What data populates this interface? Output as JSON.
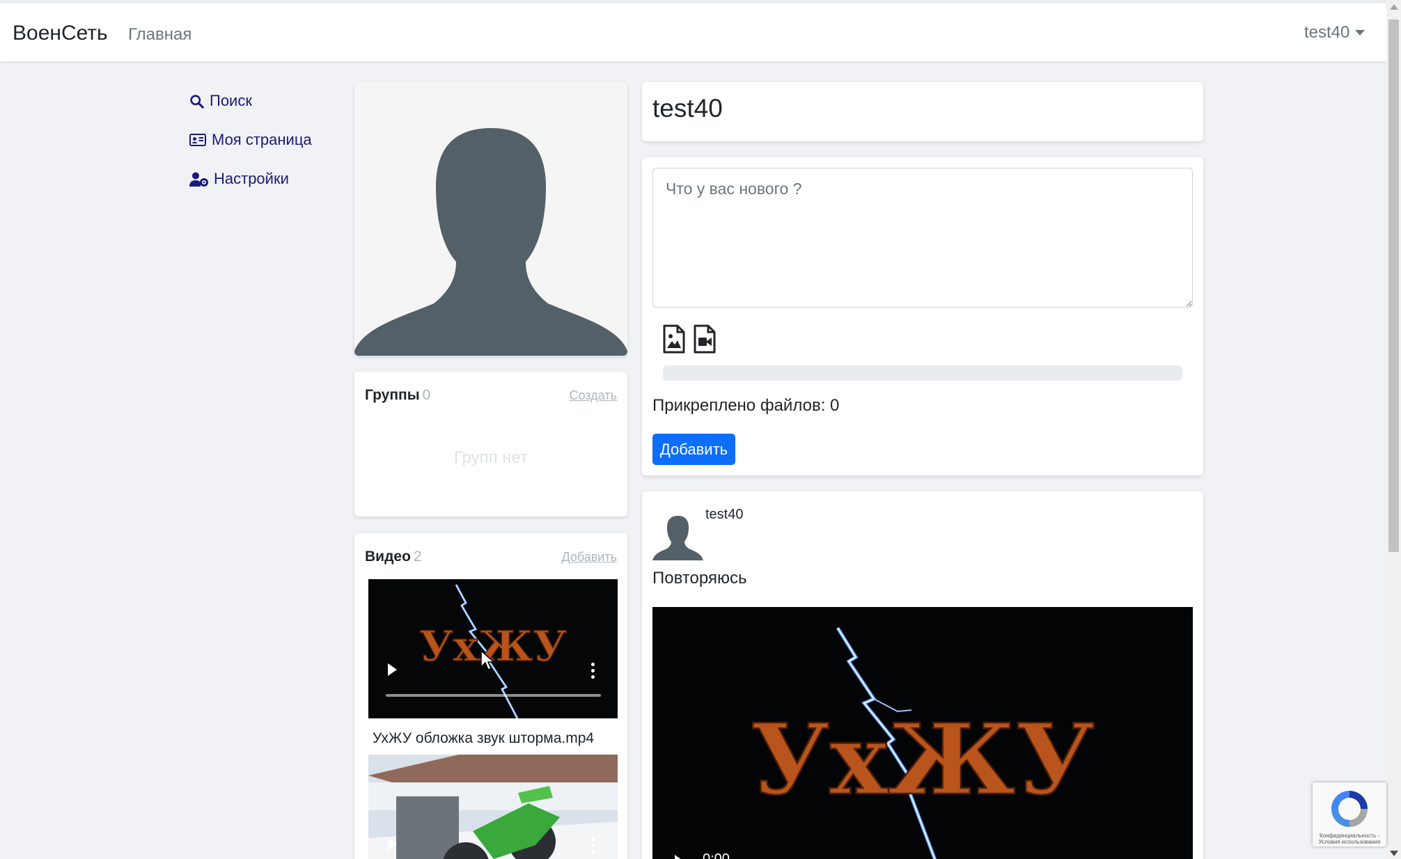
{
  "navbar": {
    "brand": "ВоенСеть",
    "home_link": "Главная",
    "user_menu": "test40"
  },
  "sidebar": {
    "items": [
      {
        "label": "Поиск",
        "icon": "search-icon"
      },
      {
        "label": "Моя страница",
        "icon": "id-card-icon"
      },
      {
        "label": "Настройки",
        "icon": "user-gear-icon"
      }
    ]
  },
  "profile": {
    "name": "test40"
  },
  "groups": {
    "title": "Группы",
    "count": "0",
    "action": "Создать",
    "empty_text": "Групп нет"
  },
  "videos": {
    "title": "Видео",
    "count": "2",
    "action": "Добавить",
    "items": [
      {
        "caption": "УхЖУ обложка звук шторма.mp4",
        "thumbnail_text": "УхЖУ"
      },
      {
        "caption": ""
      }
    ]
  },
  "post_form": {
    "placeholder": "Что у вас нового ?",
    "attached_label": "Прикреплено файлов: 0",
    "submit_label": "Добавить",
    "attach_icons": [
      "image-file-icon",
      "video-file-icon"
    ]
  },
  "post": {
    "author": "test40",
    "text": "Повторяюсь",
    "video_title_text": "УхЖУ",
    "video_time": "0:00"
  },
  "recaptcha": {
    "text": "Конфиденциальность - Условия использования"
  },
  "colors": {
    "primary": "#0d6efd",
    "link": "#1a1a7a",
    "muted": "#6c757d",
    "page_background": "#f0f2f5"
  }
}
